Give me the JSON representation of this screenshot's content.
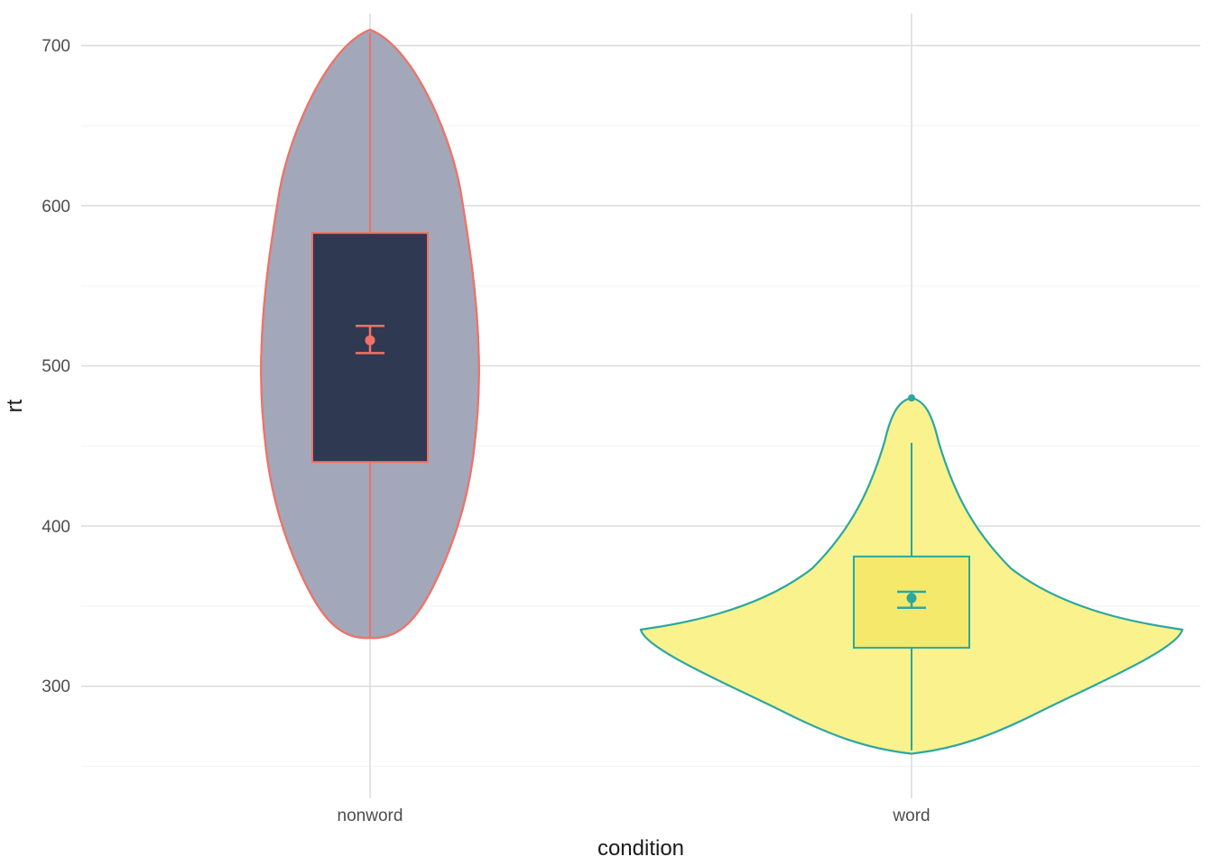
{
  "chart_data": {
    "type": "violin",
    "xlabel": "condition",
    "ylabel": "rt",
    "categories": [
      "nonword",
      "word"
    ],
    "y_ticks": [
      300,
      400,
      500,
      600,
      700
    ],
    "ylim": [
      230,
      720
    ],
    "series": [
      {
        "name": "nonword",
        "violin_range": [
          330,
          710
        ],
        "box": {
          "q1": 440,
          "median": 516,
          "q3": 583,
          "whisker_low": 330,
          "whisker_high": 708
        },
        "mean": 516,
        "se_low": 508,
        "se_high": 525,
        "stroke": "#f07167",
        "fill_violin": "#a2a8b9",
        "fill_box": "#303952"
      },
      {
        "name": "word",
        "violin_range": [
          258,
          480
        ],
        "box": {
          "q1": 324,
          "median": 355,
          "q3": 381,
          "whisker_low": 260,
          "whisker_high": 452
        },
        "outliers": [
          480
        ],
        "mean": 355,
        "se_low": 349,
        "se_high": 359,
        "stroke": "#2ba7a0",
        "fill_violin": "#f9f28d",
        "fill_box": "#f4e96a"
      }
    ]
  },
  "labels": {
    "xlabel": "condition",
    "ylabel": "rt",
    "y300": "300",
    "y400": "400",
    "y500": "500",
    "y600": "600",
    "y700": "700",
    "x_nonword": "nonword",
    "x_word": "word"
  }
}
